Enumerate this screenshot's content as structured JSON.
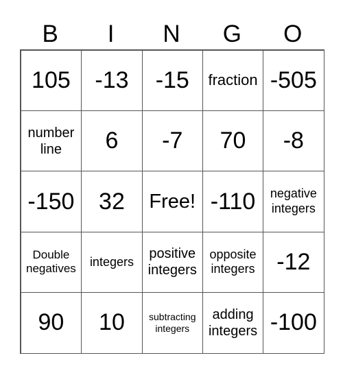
{
  "header": [
    "B",
    "I",
    "N",
    "G",
    "O"
  ],
  "cells": [
    [
      "105",
      "-13",
      "-15",
      "fraction",
      "-505"
    ],
    [
      "number line",
      "6",
      "-7",
      "70",
      "-8"
    ],
    [
      "-150",
      "32",
      "Free!",
      "-110",
      "negative integers"
    ],
    [
      "Double negatives",
      "integers",
      "positive integers",
      "opposite integers",
      "-12"
    ],
    [
      "90",
      "10",
      "subtracting integers",
      "adding integers",
      "-100"
    ]
  ]
}
